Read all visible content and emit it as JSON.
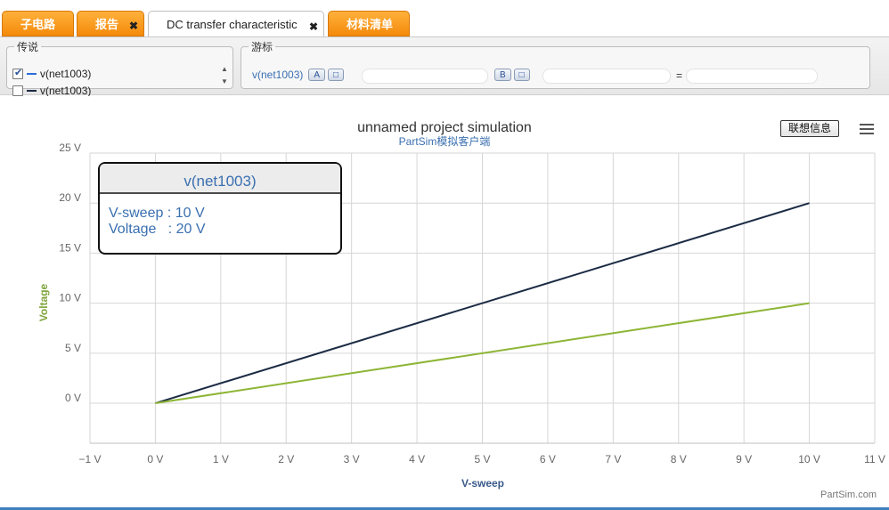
{
  "tabs": [
    {
      "label": "子电路",
      "closable": false,
      "active": false
    },
    {
      "label": "报告",
      "closable": true,
      "active": false
    },
    {
      "label": "DC transfer characteristic",
      "closable": true,
      "active": true
    },
    {
      "label": "材料清单",
      "closable": false,
      "active": false
    }
  ],
  "legend_panel": {
    "title": "传说",
    "items": [
      {
        "label": "v(net1003)",
        "checked": true,
        "color": "#2f6bd8"
      },
      {
        "label": "v(net1003)",
        "checked": false,
        "color": "#1b2b44"
      }
    ]
  },
  "cursor_panel": {
    "title": "游标",
    "signal": "v(net1003)",
    "btn_a": "A",
    "btn_b": "B",
    "btn_sub": "□",
    "equals": "="
  },
  "chart_controls": {
    "info_button": "联想信息",
    "credit": "PartSim.com"
  },
  "chart_data": {
    "type": "line",
    "title": "unnamed project simulation",
    "subtitle": "PartSim模拟客户端",
    "xlabel": "V-sweep",
    "ylabel": "Voltage",
    "xlim": [
      -1,
      11
    ],
    "ylim": [
      -4,
      25
    ],
    "x_ticks": [
      "−1 V",
      "0 V",
      "1 V",
      "2 V",
      "3 V",
      "4 V",
      "5 V",
      "6 V",
      "7 V",
      "8 V",
      "9 V",
      "10 V",
      "11 V"
    ],
    "x_tick_values": [
      -1,
      0,
      1,
      2,
      3,
      4,
      5,
      6,
      7,
      8,
      9,
      10,
      11
    ],
    "y_ticks": [
      "0 V",
      "5 V",
      "10 V",
      "15 V",
      "20 V",
      "25 V"
    ],
    "y_tick_values": [
      0,
      5,
      10,
      15,
      20,
      25
    ],
    "grid": true,
    "series": [
      {
        "x": [
          0,
          10
        ],
        "values": [
          0,
          20
        ],
        "color": "#1b2b44"
      },
      {
        "x": [
          0,
          10
        ],
        "values": [
          0,
          10
        ],
        "color": "#8db535"
      }
    ],
    "tooltip": {
      "header": "v(net1003)",
      "line1": "V-sweep : 10 V",
      "line2": "Voltage   : 20 V"
    },
    "colors": {
      "title": "#333333",
      "subtitle": "#3a6fb0",
      "axis_label_y": "#7ea33a",
      "axis_label_x": "#3a5a8a",
      "tick": "#666666",
      "grid": "#d6d6d6",
      "tooltip_text": "#3a6fb0"
    }
  }
}
